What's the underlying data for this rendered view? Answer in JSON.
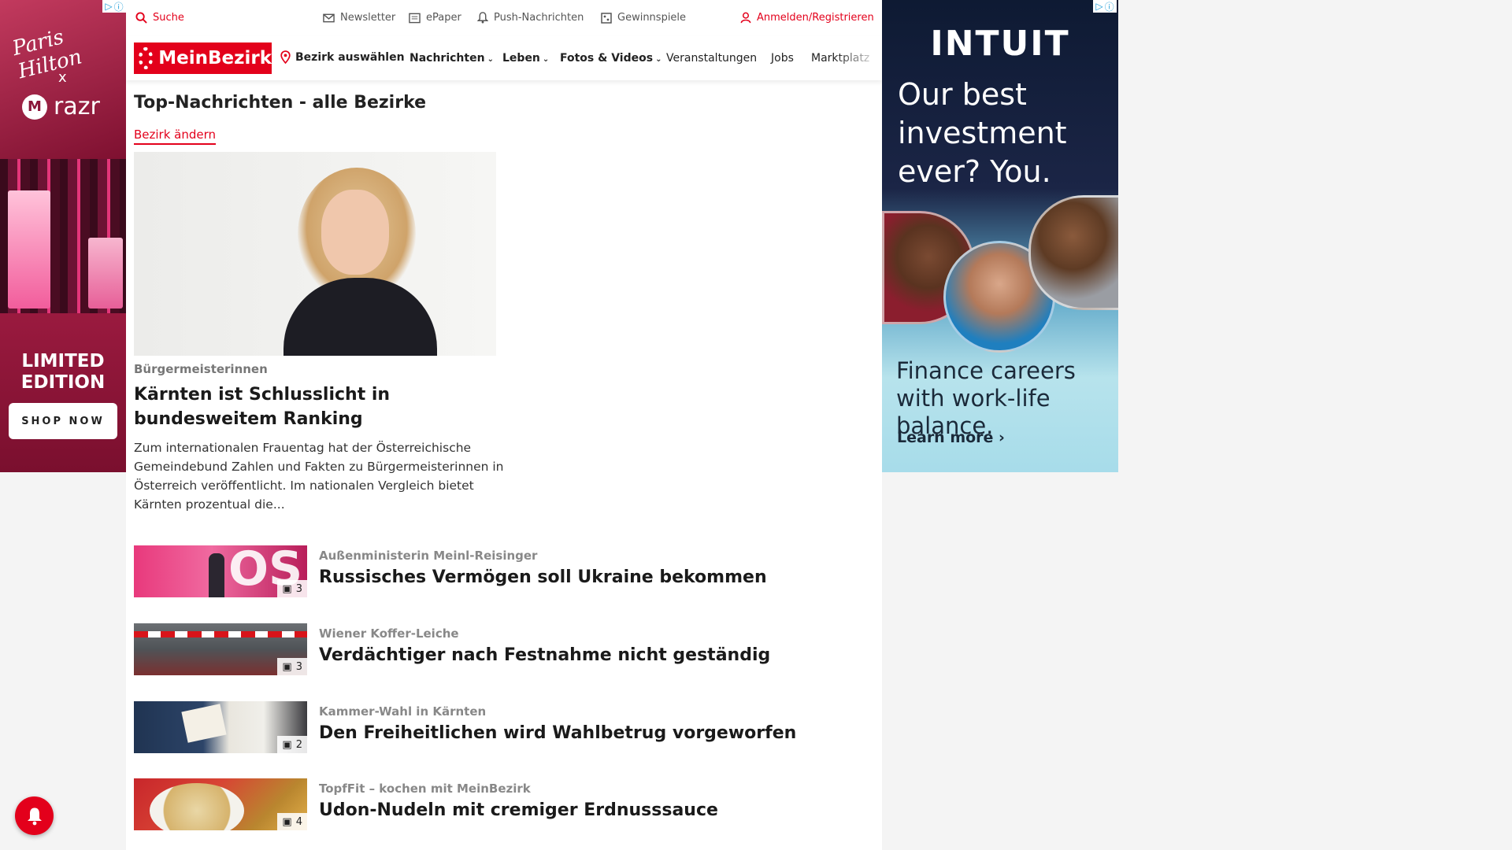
{
  "left_ad": {
    "signature": "Paris Hilton",
    "collab_x": "x",
    "brand": "razr",
    "limited_line1": "LIMITED",
    "limited_line2": "EDITION",
    "cta": "SHOP NOW",
    "ad_choice_icon": "play-triangle-icon",
    "ad_info_icon": "info-icon"
  },
  "topbar": {
    "search": "Suche",
    "newsletter": "Newsletter",
    "epaper": "ePaper",
    "push": "Push-Nachrichten",
    "gewinnspiele": "Gewinnspiele",
    "login": "Anmelden/Registrieren"
  },
  "nav": {
    "logo": "MeinBezirk",
    "bezirk": "Bezirk auswählen",
    "items": [
      {
        "label": "Nachrichten",
        "dropdown": true
      },
      {
        "label": "Leben",
        "dropdown": true
      },
      {
        "label": "Fotos & Videos",
        "dropdown": true
      },
      {
        "label": "Veranstaltungen",
        "dropdown": false
      },
      {
        "label": "Jobs",
        "dropdown": false
      },
      {
        "label": "Marktplatz",
        "dropdown": false
      }
    ]
  },
  "page": {
    "title": "Top-Nachrichten - alle Bezirke",
    "change_link": "Bezirk ändern"
  },
  "hero": {
    "kicker": "Bürgermeisterinnen",
    "title": "Kärnten ist Schlusslicht in bundesweitem Ranking",
    "teaser": "Zum internationalen Frauentag hat der Österreichische Gemeindebund Zahlen und Fakten zu Bürgermeisterinnen in Österreich veröffentlicht. Im nationalen Vergleich bietet Kärnten prozentual die..."
  },
  "articles": [
    {
      "kicker": "Außenministerin Meinl-Reisinger",
      "title": "Russisches Vermögen soll Ukraine bekommen",
      "photos": "3"
    },
    {
      "kicker": "Wiener Koffer-Leiche",
      "title": "Verdächtiger nach Festnahme nicht geständig",
      "photos": "3"
    },
    {
      "kicker": "Kammer-Wahl in Kärnten",
      "title": "Den Freiheitlichen wird Wahlbetrug vorgeworfen",
      "photos": "2"
    },
    {
      "kicker": "TopfFit – kochen mit MeinBezirk",
      "title": "Udon-Nudeln mit cremiger Erdnusssauce",
      "photos": "4"
    }
  ],
  "right_ad": {
    "brand": "INTUIT",
    "headline": "Our best investment ever? You.",
    "sub": "Finance careers with work-life balance.",
    "cta": "Learn more ›"
  },
  "colors": {
    "brand_red": "#e3001b",
    "ad_navy": "#0e1a33"
  }
}
